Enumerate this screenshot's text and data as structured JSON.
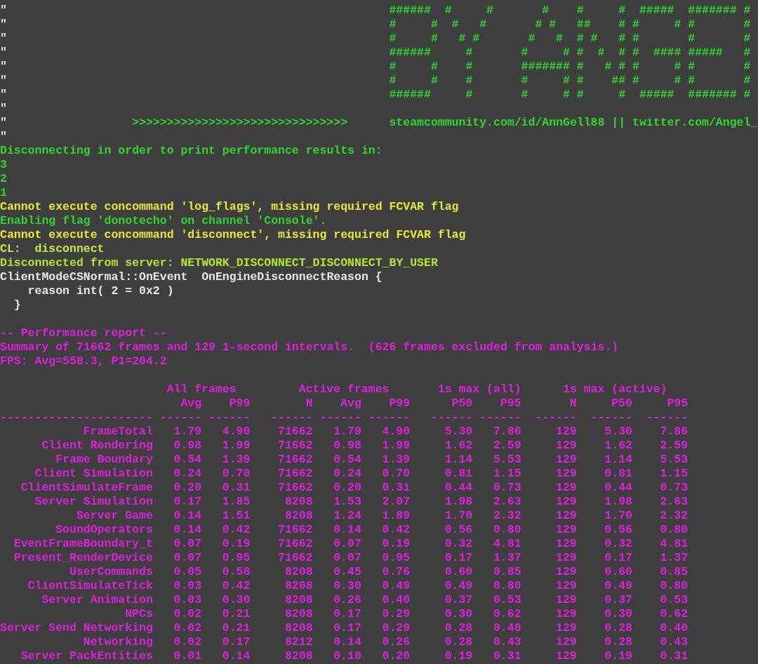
{
  "console": {
    "lines": [
      {
        "kind": "art",
        "marker": "\"",
        "art": "######  #     #       #    #     #  #####  ####### #",
        "color": "#2ed82e"
      },
      {
        "kind": "art",
        "marker": "\"",
        "art": "#     #  #   #       # #   ##    # #     # #       #",
        "color": "#2ed82e"
      },
      {
        "kind": "art",
        "marker": "\"",
        "art": "#     #   # #       #   #  # #   # #       #       #",
        "color": "#2ed82e"
      },
      {
        "kind": "art",
        "marker": "\"",
        "art": "######     #       #     # #  #  # #  #### #####   #",
        "color": "#2ed82e"
      },
      {
        "kind": "art",
        "marker": "\"",
        "art": "#     #    #       ####### #   # # #     # #       #",
        "color": "#2ed82e"
      },
      {
        "kind": "art",
        "marker": "\"",
        "art": "#     #    #       #     # #    ## #     # #       #",
        "color": "#2ed82e"
      },
      {
        "kind": "art",
        "marker": "\"",
        "art": "######     #       #     # #     #  #####  ####### #",
        "color": "#2ed82e"
      },
      {
        "kind": "marker",
        "marker": "\""
      },
      {
        "kind": "link",
        "marker": "\"",
        "arrows": ">>>>>>>>>>>>>>>>>>>>>>>>>>>>>>>",
        "url": "steamcommunity.com/id/AnnGell88 || twitter.com/Angel_",
        "color": "#2ed82e"
      },
      {
        "kind": "marker",
        "marker": "\""
      },
      {
        "kind": "log",
        "text": "Disconnecting in order to print performance results in:",
        "color": "#2ed82e"
      },
      {
        "kind": "log",
        "text": "3",
        "color": "#2ed82e"
      },
      {
        "kind": "log",
        "text": "2",
        "color": "#2ed82e"
      },
      {
        "kind": "log",
        "text": "1",
        "color": "#2ed82e"
      },
      {
        "kind": "log",
        "text": "Cannot execute concommand 'log_flags', missing required FCVAR flag",
        "color": "#e8e83a"
      },
      {
        "kind": "log",
        "text": "Enabling flag 'donotecho' on channel 'Console'.",
        "color": "#2ed82e"
      },
      {
        "kind": "log",
        "text": "Cannot execute concommand 'disconnect', missing required FCVAR flag",
        "color": "#e8e83a"
      },
      {
        "kind": "log",
        "text": "CL:  disconnect",
        "color": "#c8e84a"
      },
      {
        "kind": "log",
        "text": "Disconnected from server: NETWORK_DISCONNECT_DISCONNECT_BY_USER",
        "color": "#b4e630"
      },
      {
        "kind": "log",
        "text": "ClientModeCSNormal::OnEvent  OnEngineDisconnectReason {",
        "color": "#e8e8e8"
      },
      {
        "kind": "log",
        "text": "    reason int( 2 = 0x2 )",
        "color": "#e8e8e8"
      },
      {
        "kind": "log",
        "text": "  }",
        "color": "#e8e8e8"
      },
      {
        "kind": "blank"
      },
      {
        "kind": "log",
        "text": "-- Performance report --",
        "color": "#e020e0"
      },
      {
        "kind": "log",
        "text": "Summary of 71662 frames and 129 1-second intervals.  (626 frames excluded from analysis.)",
        "color": "#e020e0"
      },
      {
        "kind": "log",
        "text": "FPS: Avg=558.3, P1=204.2",
        "color": "#e020e0"
      },
      {
        "kind": "blank"
      }
    ]
  },
  "report": {
    "group_headers": [
      "All frames",
      "Active frames",
      "1s max (all)",
      "1s max (active)"
    ],
    "columns": [
      "Avg",
      "P99",
      "N",
      "Avg",
      "P99",
      "P50",
      "P95",
      "N",
      "P50",
      "P95"
    ],
    "rule": [
      "----------------------",
      "------",
      "------",
      "------",
      "------",
      "------",
      "------",
      "------",
      "------",
      "------",
      "------"
    ],
    "rows": [
      {
        "name": "FrameTotal",
        "values": [
          "1.79",
          "4.90",
          "71662",
          "1.79",
          "4.90",
          "5.30",
          "7.86",
          "129",
          "5.30",
          "7.86"
        ]
      },
      {
        "name": "Client Rendering",
        "values": [
          "0.98",
          "1.99",
          "71662",
          "0.98",
          "1.99",
          "1.62",
          "2.59",
          "129",
          "1.62",
          "2.59"
        ]
      },
      {
        "name": "Frame Boundary",
        "values": [
          "0.54",
          "1.39",
          "71662",
          "0.54",
          "1.39",
          "1.14",
          "5.53",
          "129",
          "1.14",
          "5.53"
        ]
      },
      {
        "name": "Client Simulation",
        "values": [
          "0.24",
          "0.70",
          "71662",
          "0.24",
          "0.70",
          "0.81",
          "1.15",
          "129",
          "0.81",
          "1.15"
        ]
      },
      {
        "name": "ClientSimulateFrame",
        "values": [
          "0.20",
          "0.31",
          "71662",
          "0.20",
          "0.31",
          "0.44",
          "0.73",
          "129",
          "0.44",
          "0.73"
        ]
      },
      {
        "name": "Server Simulation",
        "values": [
          "0.17",
          "1.85",
          "8208",
          "1.53",
          "2.07",
          "1.98",
          "2.63",
          "129",
          "1.98",
          "2.63"
        ]
      },
      {
        "name": "Server Game",
        "values": [
          "0.14",
          "1.51",
          "8208",
          "1.24",
          "1.89",
          "1.70",
          "2.32",
          "129",
          "1.70",
          "2.32"
        ]
      },
      {
        "name": "SoundOperators",
        "values": [
          "0.14",
          "0.42",
          "71662",
          "0.14",
          "0.42",
          "0.56",
          "0.80",
          "129",
          "0.56",
          "0.80"
        ]
      },
      {
        "name": "EventFrameBoundary_t",
        "values": [
          "0.07",
          "0.19",
          "71662",
          "0.07",
          "0.19",
          "0.32",
          "4.81",
          "129",
          "0.32",
          "4.81"
        ]
      },
      {
        "name": "Present_RenderDevice",
        "values": [
          "0.07",
          "0.95",
          "71662",
          "0.07",
          "0.95",
          "0.17",
          "1.37",
          "129",
          "0.17",
          "1.37"
        ]
      },
      {
        "name": "UserCommands",
        "values": [
          "0.05",
          "0.58",
          "8208",
          "0.45",
          "0.76",
          "0.60",
          "0.85",
          "129",
          "0.60",
          "0.85"
        ]
      },
      {
        "name": "ClientSimulateTick",
        "values": [
          "0.03",
          "0.42",
          "8208",
          "0.30",
          "0.49",
          "0.49",
          "0.80",
          "129",
          "0.49",
          "0.80"
        ]
      },
      {
        "name": "Server Animation",
        "values": [
          "0.03",
          "0.30",
          "8208",
          "0.26",
          "0.40",
          "0.37",
          "0.53",
          "129",
          "0.37",
          "0.53"
        ]
      },
      {
        "name": "NPCs",
        "values": [
          "0.02",
          "0.21",
          "8208",
          "0.17",
          "0.29",
          "0.30",
          "0.62",
          "129",
          "0.30",
          "0.62"
        ]
      },
      {
        "name": "Server Send Networking",
        "values": [
          "0.02",
          "0.21",
          "8208",
          "0.17",
          "0.29",
          "0.28",
          "0.40",
          "129",
          "0.28",
          "0.40"
        ]
      },
      {
        "name": "Networking",
        "values": [
          "0.02",
          "0.17",
          "8212",
          "0.14",
          "0.26",
          "0.28",
          "0.43",
          "129",
          "0.28",
          "0.43"
        ]
      },
      {
        "name": "Server PackEntities",
        "values": [
          "0.01",
          "0.14",
          "8208",
          "0.10",
          "0.20",
          "0.19",
          "0.31",
          "129",
          "0.19",
          "0.31"
        ]
      }
    ]
  }
}
